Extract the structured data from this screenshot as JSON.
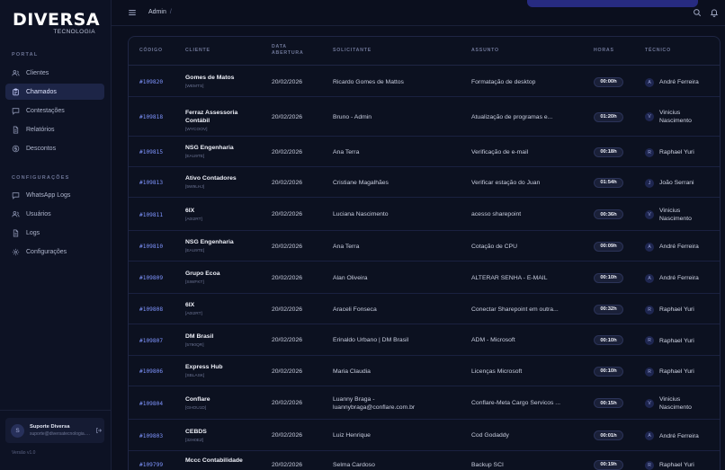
{
  "logo": {
    "main": "DIVERSA",
    "sub": "TECNOLOGIA"
  },
  "sidebar": {
    "section_portal": "PORTAL",
    "section_config": "CONFIGURAÇÕES",
    "portal_items": [
      {
        "label": "Clientes",
        "icon": "users-icon"
      },
      {
        "label": "Chamados",
        "icon": "clipboard-icon",
        "active": true
      },
      {
        "label": "Contestações",
        "icon": "chat-icon"
      },
      {
        "label": "Relatórios",
        "icon": "file-icon"
      },
      {
        "label": "Descontos",
        "icon": "dollar-icon"
      }
    ],
    "config_items": [
      {
        "label": "WhatsApp Logs",
        "icon": "chat-icon"
      },
      {
        "label": "Usuários",
        "icon": "users-icon"
      },
      {
        "label": "Logs",
        "icon": "file-icon"
      },
      {
        "label": "Configurações",
        "icon": "gear-icon"
      }
    ],
    "user": {
      "initial": "S",
      "name": "Suporte Diversa",
      "email": "suporte@diversatecnologia.com.br"
    },
    "version": "Versão v1.0"
  },
  "topbar": {
    "breadcrumb": "Admin",
    "separator": "/"
  },
  "table": {
    "headers": {
      "code": "CÓDIGO",
      "client": "CLIENTE",
      "date_line1": "DATA",
      "date_line2": "ABERTURA",
      "requester": "SOLICITANTE",
      "subject": "ASSUNTO",
      "hours": "HORAS",
      "tech": "TÉCNICO"
    },
    "rows": [
      {
        "code": "#109820",
        "client": "Gomes de Matos",
        "client_code": "[WEMTS]",
        "date": "20/02/2026",
        "requester": "Ricardo Gomes de Mattos",
        "subject": "Formatação de desktop",
        "hours": "00:00h",
        "tech_initial": "A",
        "tech": "André Ferreira"
      },
      {
        "code": "#109818",
        "client": "Ferraz Assessoria Contábil",
        "client_code": "[WYCOOV]",
        "date": "20/02/2026",
        "requester": "Bruno - Admin",
        "subject": "Atualização de programas e...",
        "hours": "01:20h",
        "tech_initial": "V",
        "tech": "Vinicius Nascimento"
      },
      {
        "code": "#109815",
        "client": "NSG Engenharia",
        "client_code": "[EAU9TE]",
        "date": "20/02/2026",
        "requester": "Ana Terra",
        "subject": "Verificação de e-mail",
        "hours": "00:18h",
        "tech_initial": "R",
        "tech": "Raphael Yuri"
      },
      {
        "code": "#109813",
        "client": "Ativo Contadores",
        "client_code": "[5W9LHJ]",
        "date": "20/02/2026",
        "requester": "Cristiane Magalhães",
        "subject": "Verificar estação do Juan",
        "hours": "01:54h",
        "tech_initial": "J",
        "tech": "João Serrani"
      },
      {
        "code": "#109811",
        "client": "6IX",
        "client_code": "[A0I2RT]",
        "date": "20/02/2026",
        "requester": "Luciana Nascimento",
        "subject": "acesso sharepoint",
        "hours": "00:36h",
        "tech_initial": "V",
        "tech": "Vinicius Nascimento"
      },
      {
        "code": "#109810",
        "client": "NSG Engenharia",
        "client_code": "[EAU9TE]",
        "date": "20/02/2026",
        "requester": "Ana Terra",
        "subject": "Cotação de CPU",
        "hours": "00:09h",
        "tech_initial": "A",
        "tech": "André Ferreira"
      },
      {
        "code": "#109809",
        "client": "Grupo Ecoa",
        "client_code": "[SIWFKT]",
        "date": "20/02/2026",
        "requester": "Alan Oliveira",
        "subject": "ALTERAR SENHA - E-MAIL",
        "hours": "00:10h",
        "tech_initial": "A",
        "tech": "André Ferreira"
      },
      {
        "code": "#109808",
        "client": "6IX",
        "client_code": "[A0I2RT]",
        "date": "20/02/2026",
        "requester": "Araceli Fonseca",
        "subject": "Conectar Sharepoint em outra...",
        "hours": "00:32h",
        "tech_initial": "R",
        "tech": "Raphael Yuri"
      },
      {
        "code": "#109807",
        "client": "DM Brasil",
        "client_code": "[5790QR]",
        "date": "20/02/2026",
        "requester": "Erinaldo Urbano | DM Brasil",
        "subject": "ADM - Microsoft",
        "hours": "00:10h",
        "tech_initial": "R",
        "tech": "Raphael Yuri"
      },
      {
        "code": "#109806",
        "client": "Express Hub",
        "client_code": "[SBLASK]",
        "date": "20/02/2026",
        "requester": "Maria Claudia",
        "subject": "Licenças Microsoft",
        "hours": "00:10h",
        "tech_initial": "R",
        "tech": "Raphael Yuri"
      },
      {
        "code": "#109804",
        "client": "Conflare",
        "client_code": "[GHOU1D]",
        "date": "20/02/2026",
        "requester": "Luanny Braga - luannybraga@conflare.com.br",
        "subject": "Conflare-Meta Cargo Servicos ...",
        "hours": "00:15h",
        "tech_initial": "V",
        "tech": "Vinicius Nascimento"
      },
      {
        "code": "#109803",
        "client": "CEBDS",
        "client_code": "[32H0EZ]",
        "date": "20/02/2026",
        "requester": "Luiz Henrique",
        "subject": "Cod Godaddy",
        "hours": "00:01h",
        "tech_initial": "A",
        "tech": "André Ferreira"
      },
      {
        "code": "#109799",
        "client": "Mccc Contabilidade",
        "client_code": "",
        "date": "20/02/2026",
        "requester": "Selma Cardoso",
        "subject": "Backup SCI",
        "hours": "00:19h",
        "tech_initial": "R",
        "tech": "Raphael Yuri"
      }
    ]
  }
}
